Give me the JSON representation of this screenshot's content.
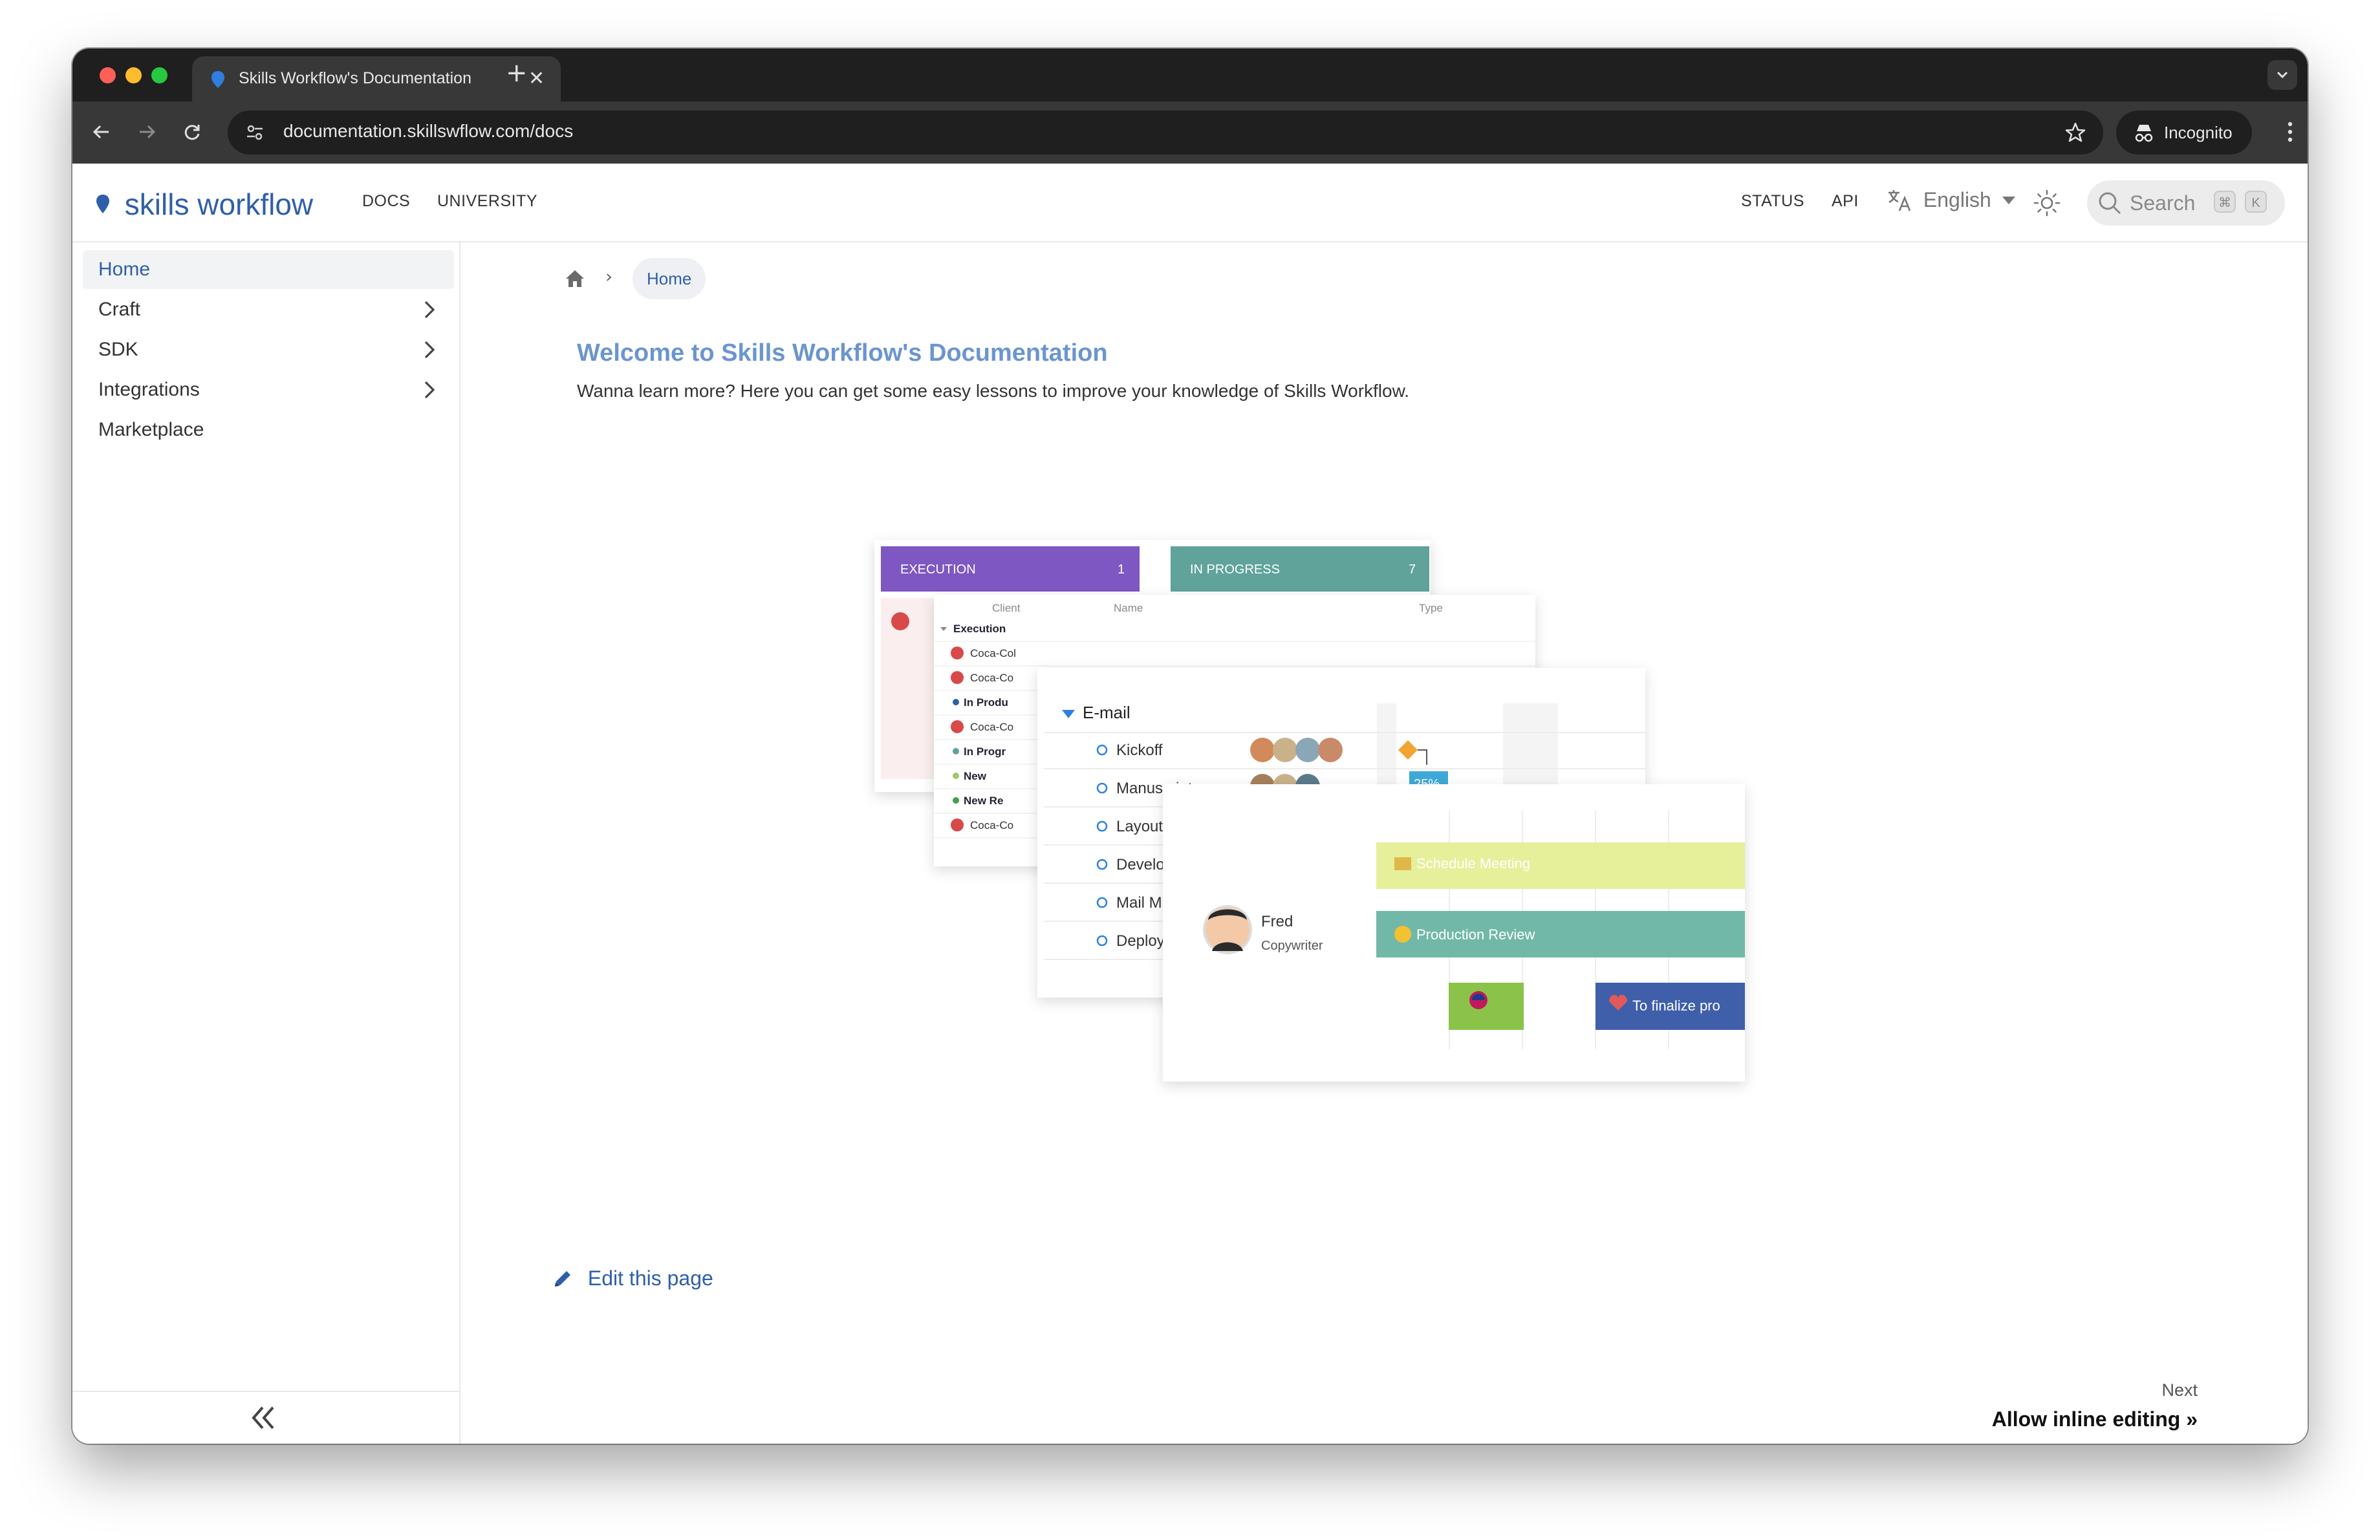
{
  "browser": {
    "tab_title": "Skills Workflow's Documentation",
    "tab_close": "✕",
    "new_tab": "+",
    "url": "documentation.skillswflow.com/docs",
    "profile_label": "Incognito"
  },
  "header": {
    "logo_text": "skills workflow",
    "nav": [
      "DOCS",
      "UNIVERSITY"
    ],
    "right_nav": [
      "STATUS",
      "API"
    ],
    "language": "English",
    "search_placeholder": "Search",
    "shortcut_keys": [
      "⌘",
      "K"
    ]
  },
  "sidebar": {
    "items": [
      {
        "label": "Home",
        "active": true,
        "expandable": false
      },
      {
        "label": "Craft",
        "active": false,
        "expandable": true
      },
      {
        "label": "SDK",
        "active": false,
        "expandable": true
      },
      {
        "label": "Integrations",
        "active": false,
        "expandable": true
      },
      {
        "label": "Marketplace",
        "active": false,
        "expandable": false
      }
    ]
  },
  "breadcrumb": {
    "separator": "›",
    "current": "Home"
  },
  "content": {
    "title": "Welcome to Skills Workflow's Documentation",
    "intro": "Wanna learn more? Here you can get some easy lessons to improve your knowledge of Skills Workflow.",
    "edit_link": "Edit this page",
    "next_label": "Next",
    "next_title": "Allow inline editing »"
  },
  "hero": {
    "kanban": [
      {
        "label": "EXECUTION",
        "count": "1",
        "color": "#7e57c2"
      },
      {
        "label": "IN PROGRESS",
        "count": "7",
        "color": "#5fa39a"
      }
    ],
    "table_headers": [
      "Client",
      "Name",
      "Type"
    ],
    "table_rows": [
      {
        "label": "Execution",
        "kind": "group"
      },
      {
        "label": "Coca-Col",
        "kind": "client"
      },
      {
        "label": "Coca-Co",
        "kind": "client"
      },
      {
        "label": "In Produ",
        "kind": "status",
        "dot": "#2f5fa8"
      },
      {
        "label": "Coca-Co",
        "kind": "client"
      },
      {
        "label": "In Progr",
        "kind": "status",
        "dot": "#5fa39a"
      },
      {
        "label": "New",
        "kind": "status",
        "dot": "#9ccc65"
      },
      {
        "label": "New Re",
        "kind": "status",
        "dot": "#43a047"
      },
      {
        "label": "Coca-Co",
        "kind": "client"
      }
    ],
    "gantt_group": "E-mail",
    "gantt_tasks": [
      "Kickoff",
      "Manuscript",
      "Layout",
      "Develo",
      "Mail M",
      "Deploy"
    ],
    "progress_badge": "25%",
    "person_name": "Fred",
    "person_role": "Copywriter",
    "events": [
      {
        "label": "Schedule Meeting",
        "color": "#e6ef9a"
      },
      {
        "label": "Production Review",
        "color": "#72b8a8"
      },
      {
        "label": "To finalize pro",
        "color": "#3f5faa"
      }
    ],
    "small_event_color": "#8bc34a"
  },
  "colors": {
    "brand": "#2f5fa8",
    "title": "#6b95cf",
    "chrome_dark": "#1f1f1f",
    "chrome_toolbar": "#383838"
  }
}
